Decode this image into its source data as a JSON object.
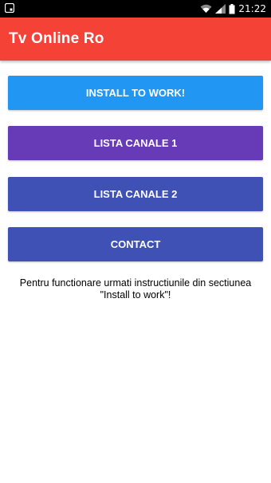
{
  "status_bar": {
    "time": "21:22",
    "icons": [
      "notification-icon",
      "wifi-icon",
      "signal-icon",
      "battery-icon"
    ]
  },
  "app": {
    "title": "Tv Online Ro",
    "accent_color": "#f44336"
  },
  "buttons": [
    {
      "label": "INSTALL TO WORK!",
      "color": "#2196f3"
    },
    {
      "label": "LISTA CANALE 1",
      "color": "#673ab7"
    },
    {
      "label": "LISTA CANALE 2",
      "color": "#3f51b5"
    },
    {
      "label": "CONTACT",
      "color": "#3f51b5"
    }
  ],
  "message": "Pentru functionare urmati instructiunile din sectiunea \"Install to work\"!"
}
